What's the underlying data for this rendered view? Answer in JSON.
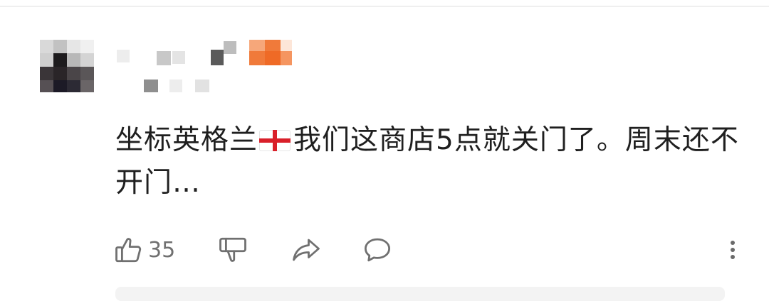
{
  "comment": {
    "text_part1": "坐标英格兰",
    "flag_icon": "england-flag-icon",
    "text_part2": "我们这商店5点就关门了。周末还不开门…"
  },
  "actions": {
    "like_count": "35",
    "like_icon": "thumbs-up-icon",
    "dislike_icon": "thumbs-down-icon",
    "share_icon": "share-icon",
    "reply_icon": "comment-icon",
    "more_icon": "more-vertical-icon"
  },
  "colors": {
    "text": "#1f1f1f",
    "icon": "#707070",
    "flag_red": "#d9202a",
    "name_highlight": "#f07a3a"
  }
}
